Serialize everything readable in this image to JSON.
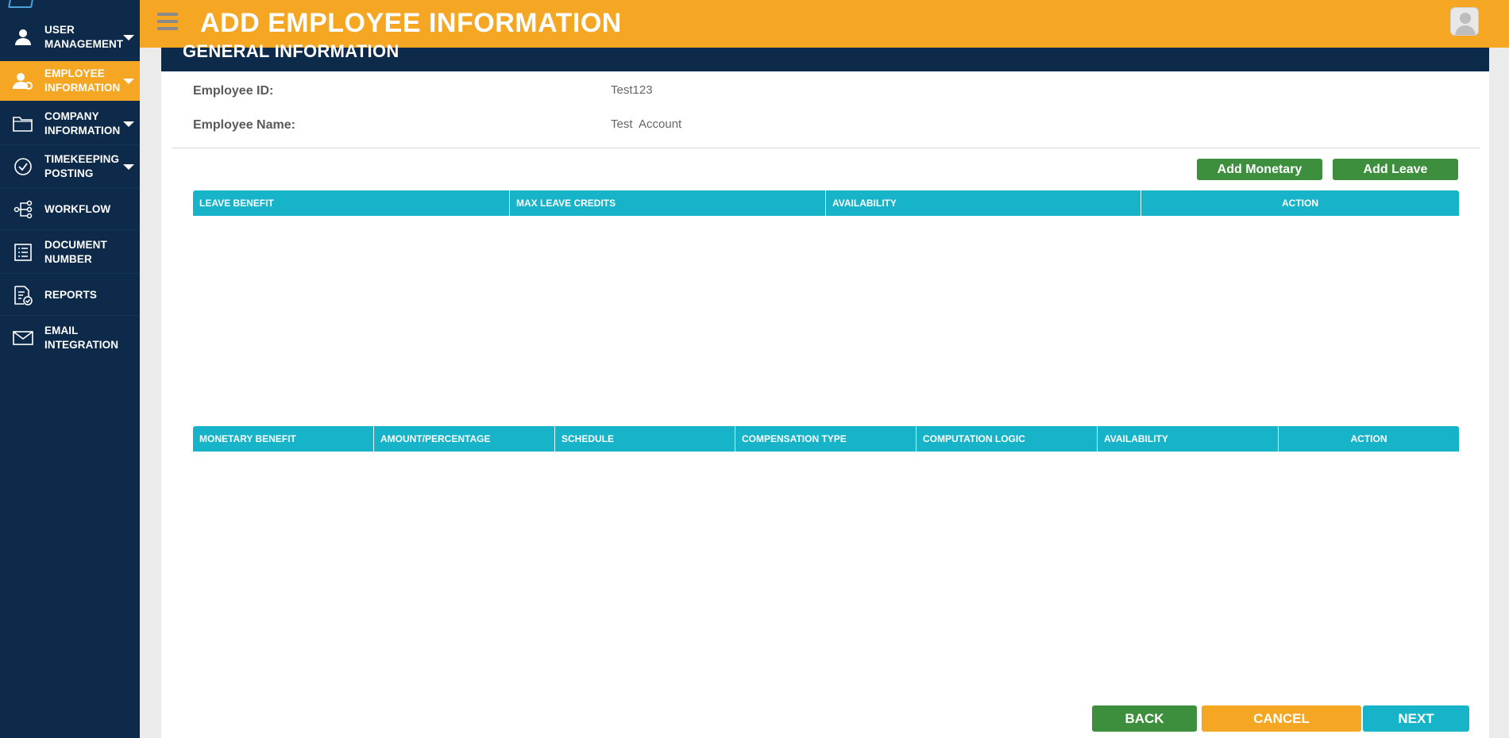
{
  "sidebar": {
    "items": [
      {
        "label": "USER MANAGEMENT",
        "icon": "user-icon",
        "has_caret": true
      },
      {
        "label": "EMPLOYEE INFORMATION",
        "icon": "employee-icon",
        "has_caret": true,
        "active": true
      },
      {
        "label": "COMPANY INFORMATION",
        "icon": "folder-icon",
        "has_caret": true
      },
      {
        "label": "TIMEKEEPING POSTING",
        "icon": "check-circle-icon",
        "has_caret": true
      },
      {
        "label": "WORKFLOW",
        "icon": "workflow-icon",
        "has_caret": false
      },
      {
        "label": "DOCUMENT NUMBER",
        "icon": "document-list-icon",
        "has_caret": false
      },
      {
        "label": "REPORTS",
        "icon": "report-icon",
        "has_caret": false
      },
      {
        "label": "EMAIL INTEGRATION",
        "icon": "envelope-icon",
        "has_caret": false
      }
    ],
    "accent_color": "#f5a623",
    "background_color": "#0e2a4a"
  },
  "header": {
    "title": "ADD EMPLOYEE INFORMATION",
    "background_color": "#f5a623"
  },
  "general_info": {
    "title": "GENERAL INFORMATION",
    "fields": [
      {
        "label": "Employee ID:",
        "value": "Test123"
      },
      {
        "label": "Employee Name:",
        "value": "Test  Account"
      }
    ]
  },
  "actions": {
    "add_monetary": "Add Monetary",
    "add_leave": "Add Leave"
  },
  "leave_table": {
    "columns": [
      "LEAVE BENEFIT",
      "MAX LEAVE CREDITS",
      "AVAILABILITY",
      "ACTION"
    ],
    "rows": []
  },
  "monetary_table": {
    "columns": [
      "MONETARY BENEFIT",
      "AMOUNT/PERCENTAGE",
      "SCHEDULE",
      "COMPENSATION TYPE",
      "COMPUTATION LOGIC",
      "AVAILABILITY",
      "ACTION"
    ],
    "rows": []
  },
  "footer": {
    "back": "BACK",
    "cancel": "CANCEL",
    "next": "NEXT"
  },
  "colors": {
    "table_header": "#17b3c8",
    "green_button": "#3d8f3d",
    "navy": "#0e2a4a"
  }
}
